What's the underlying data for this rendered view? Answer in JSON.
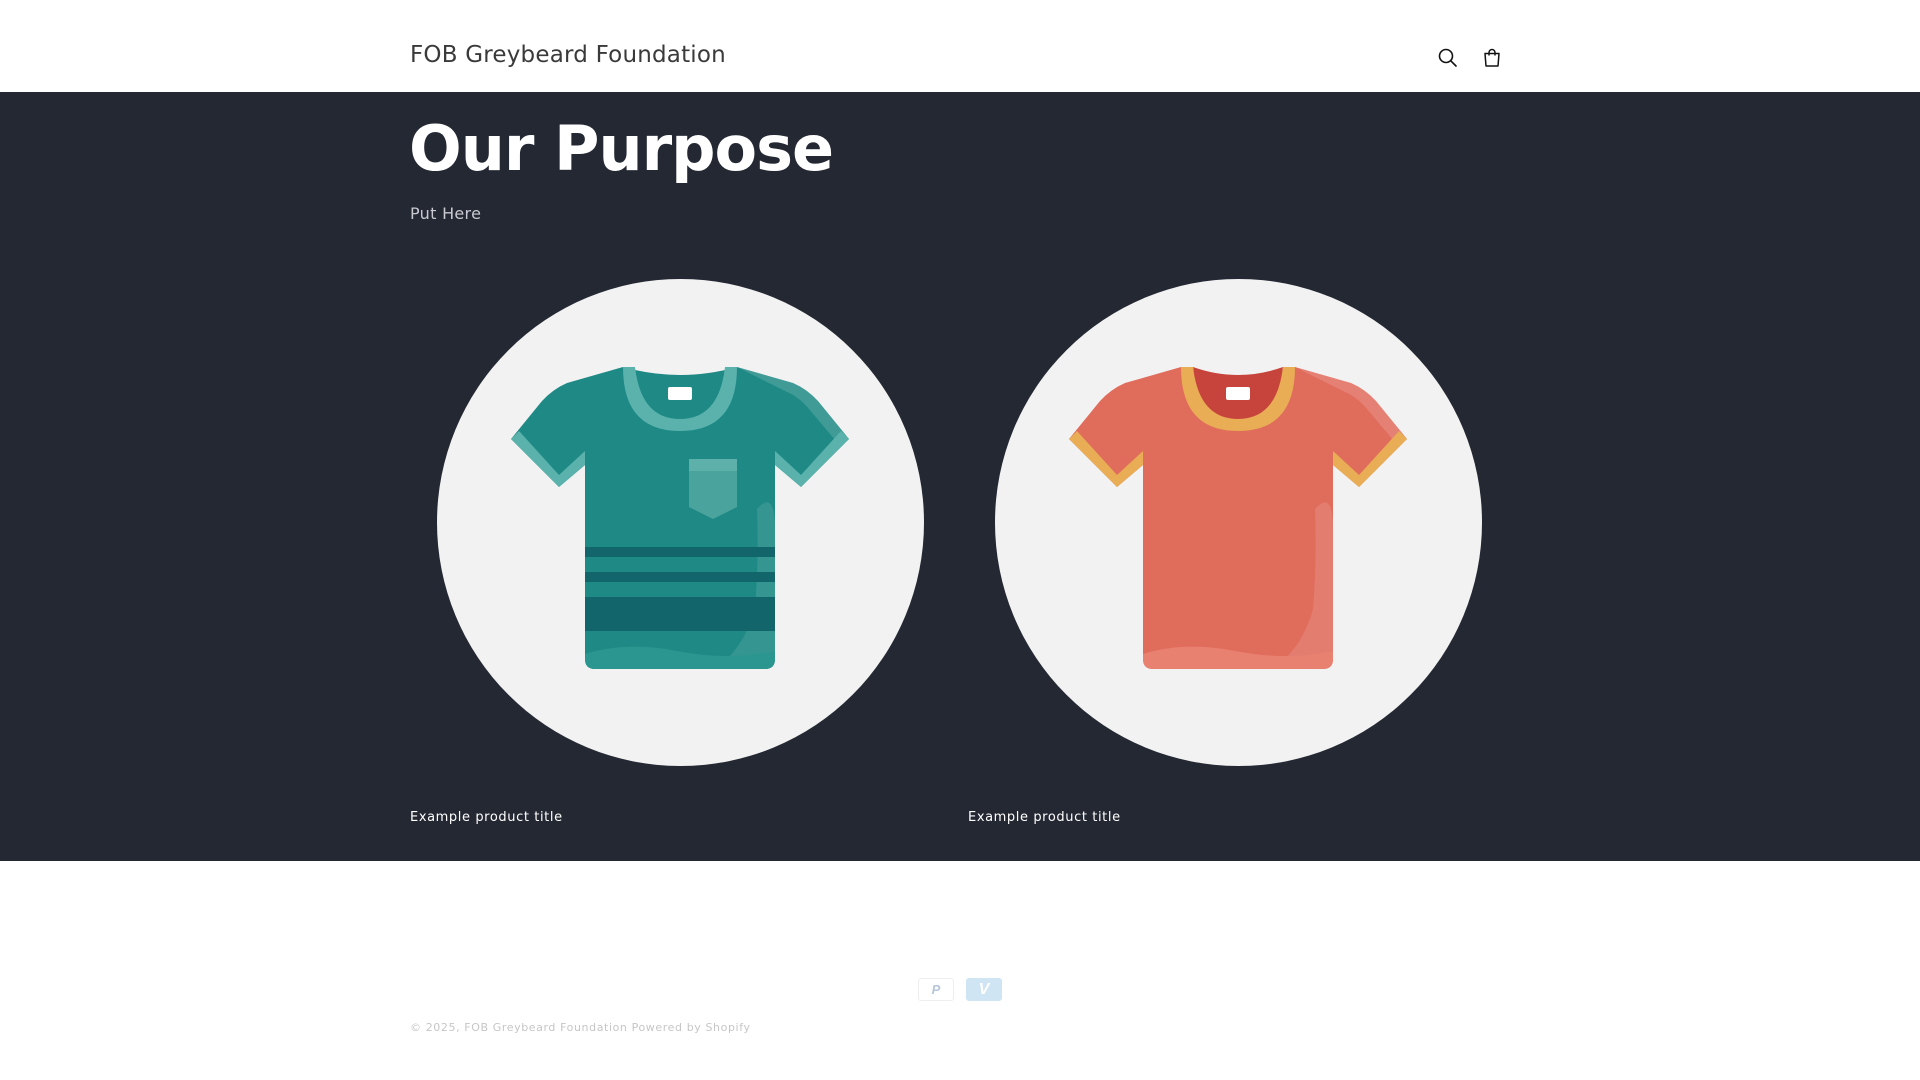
{
  "header": {
    "brand": "FOB Greybeard Foundation",
    "icons": {
      "search": "search-icon",
      "cart": "cart-icon"
    }
  },
  "hero": {
    "title": "Our Purpose",
    "subtitle": "Put Here",
    "background": "#242833"
  },
  "products": [
    {
      "title": "Example product title",
      "shirt_color": "#1f8a85",
      "icon": "teal-tshirt-icon"
    },
    {
      "title": "Example product title",
      "shirt_color": "#e06c5c",
      "icon": "coral-tshirt-icon"
    }
  ],
  "footer": {
    "payment_icons": [
      "paypal-icon",
      "venmo-icon"
    ],
    "paypal_glyph": "P",
    "venmo_glyph": "V",
    "copyright_prefix": "© 2025,",
    "copyright_brand": "FOB Greybeard Foundation",
    "powered_by": "Powered by Shopify"
  }
}
